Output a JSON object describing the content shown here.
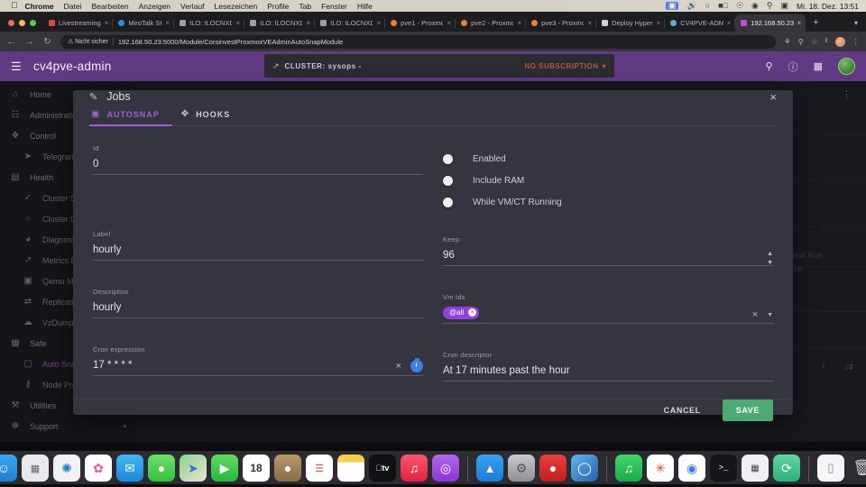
{
  "os_menubar": {
    "apple_icon": "apple-logo",
    "items": [
      "Chrome",
      "Datei",
      "Bearbeiten",
      "Anzeigen",
      "Verlauf",
      "Lesezeichen",
      "Profile",
      "Tab",
      "Fenster",
      "Hilfe"
    ],
    "status_icons": [
      "screen-share-icon",
      "volume-icon",
      "control-center-icon",
      "battery-icon",
      "airdrop-icon",
      "wifi-icon",
      "search-icon",
      "user-switch-icon"
    ],
    "clock": "Mi. 18. Dez.  13:51"
  },
  "browser": {
    "traffic_lights": [
      "close",
      "minimize",
      "zoom"
    ],
    "tabs": [
      {
        "label": "Livestreaming",
        "favicon_color": "#e0443e",
        "active": false
      },
      {
        "label": "MiroTalk SI",
        "favicon_color": "#2f8fd6",
        "active": false
      },
      {
        "label": "ILO: ILOCNXD",
        "favicon_color": "#9aa0a6",
        "active": false
      },
      {
        "label": "ILO: ILOCNXD",
        "favicon_color": "#9aa0a6",
        "active": false
      },
      {
        "label": "ILO: ILOCNXD",
        "favicon_color": "#9aa0a6",
        "active": false
      },
      {
        "label": "pve1 - Proxmo",
        "favicon_color": "#e8803a",
        "active": false
      },
      {
        "label": "pve2 - Proxmo",
        "favicon_color": "#e8803a",
        "active": false
      },
      {
        "label": "pve3 - Proxmo",
        "favicon_color": "#e8803a",
        "active": false
      },
      {
        "label": "Deploy Hyper",
        "favicon_color": "#d0d0d4",
        "active": false
      },
      {
        "label": "CV4PVE-ADM",
        "favicon_color": "#5ab0c8",
        "active": false
      },
      {
        "label": "192.168.50.23",
        "favicon_color": "#b44fd8",
        "active": true
      }
    ],
    "new_tab_label": "+",
    "tab_list_chevron": "chevron-down-icon",
    "nav": {
      "back": "←",
      "forward": "→",
      "reload": "↻"
    },
    "omnibox": {
      "security_label": "Nicht sicher",
      "security_icon": "warning-triangle-icon",
      "url": "192.168.50.23:5000/Module/CorsinvestProxmoxVEAdminAutoSnapModule"
    },
    "toolbar_icons": [
      "extensions-icon",
      "zoom-icon",
      "bookmark-star-icon",
      "downloads-icon",
      "profile-avatar",
      "menu-kebab-icon"
    ]
  },
  "app_header": {
    "menu_icon": "hamburger-menu-icon",
    "brand": "cv4pve-admin",
    "cluster_icon": "external-link-icon",
    "cluster_label": "CLUSTER: sysops -",
    "subscription_label": "NO SUBSCRIPTION",
    "subscription_caret": "caret-down-icon",
    "icons": [
      "search-icon",
      "help-icon",
      "apps-grid-icon"
    ],
    "avatar": "user-avatar"
  },
  "sidebar": {
    "items": [
      {
        "label": "Home",
        "icon": "home-icon",
        "sub": false,
        "active": false
      },
      {
        "label": "Administration",
        "icon": "administration-icon",
        "sub": false,
        "active": false
      },
      {
        "label": "Control",
        "icon": "control-icon",
        "sub": false,
        "active": false
      },
      {
        "label": "Telegram",
        "icon": "telegram-icon",
        "sub": true,
        "active": false
      },
      {
        "label": "Health",
        "icon": "health-icon",
        "sub": false,
        "active": false
      },
      {
        "label": "Cluster S",
        "icon": "cluster-status-icon",
        "sub": true,
        "active": false
      },
      {
        "label": "Cluster U",
        "icon": "cluster-update-icon",
        "sub": true,
        "active": false
      },
      {
        "label": "Diagnostic",
        "icon": "stethoscope-icon",
        "sub": true,
        "active": false
      },
      {
        "label": "Metrics E",
        "icon": "metrics-icon",
        "sub": true,
        "active": false
      },
      {
        "label": "Qemu Mo",
        "icon": "qemu-monitor-icon",
        "sub": true,
        "active": false
      },
      {
        "label": "Replication",
        "icon": "replication-icon",
        "sub": true,
        "active": false
      },
      {
        "label": "VzDump",
        "icon": "vzdump-cloud-icon",
        "sub": true,
        "active": false
      },
      {
        "label": "Safe",
        "icon": "safe-icon",
        "sub": false,
        "active": false
      },
      {
        "label": "Auto Snapshot",
        "icon": "auto-snapshot-icon",
        "sub": true,
        "active": true
      },
      {
        "label": "Node Protection",
        "icon": "shield-icon",
        "sub": true,
        "active": false
      },
      {
        "label": "Utilities",
        "icon": "utilities-icon",
        "sub": false,
        "active": false
      },
      {
        "label": "Support",
        "icon": "support-icon",
        "sub": false,
        "active": false,
        "chevron": "chevron-down-icon"
      }
    ]
  },
  "background_page": {
    "kebab_icon": "more-vertical-icon",
    "column_header": "Next Run",
    "cell_text": "ne",
    "pager_next": "next-page-icon",
    "pager_last": "last-page-icon"
  },
  "dialog": {
    "title": "Jobs",
    "title_icon": "pencil-edit-icon",
    "close_icon": "close-icon",
    "tabs": [
      {
        "label": "AUTOSNAP",
        "icon": "camera-icon",
        "selected": true
      },
      {
        "label": "HOOKS",
        "icon": "hooks-move-icon",
        "selected": false
      }
    ],
    "fields": {
      "id": {
        "label": "Id",
        "value": "0"
      },
      "label": {
        "label": "Label",
        "value": "hourly"
      },
      "description": {
        "label": "Description",
        "value": "hourly"
      },
      "cron_expression": {
        "label": "Cron expression",
        "value": "17 * * * *",
        "clear_icon": "close-icon",
        "timer_icon": "timer-icon"
      },
      "keep": {
        "label": "Keep",
        "value": "96",
        "spinner_up": "chevron-up-icon",
        "spinner_down": "chevron-down-icon"
      },
      "vm_ids": {
        "label": "Vm Ids",
        "chip": "@all",
        "chip_remove_icon": "chip-close-icon",
        "clear_icon": "close-icon",
        "dropdown_icon": "caret-down-icon"
      },
      "cron_descriptor": {
        "label": "Cron descriptor",
        "value": "At 17 minutes past the hour"
      }
    },
    "toggles": [
      {
        "label": "Enabled",
        "state": "off"
      },
      {
        "label": "Include RAM",
        "state": "off"
      },
      {
        "label": "While VM/CT Running",
        "state": "off"
      }
    ],
    "buttons": {
      "cancel": "CANCEL",
      "save": "SAVE"
    }
  },
  "dock": {
    "items": [
      {
        "name": "finder",
        "glyph": "☺",
        "bg": "linear-gradient(to bottom,#39a7ef,#1f7fd0)",
        "running": true
      },
      {
        "name": "launchpad",
        "glyph": "☰",
        "bg": "#e9e9ec",
        "running": false
      },
      {
        "name": "safari",
        "glyph": "✦",
        "bg": "#f2f2f4",
        "running": false
      },
      {
        "name": "photos",
        "glyph": "✿",
        "bg": "#ffffff",
        "running": false
      },
      {
        "name": "mail",
        "glyph": "✉",
        "bg": "linear-gradient(to bottom,#42b6f5,#1e86df)",
        "running": false
      },
      {
        "name": "messages",
        "glyph": "◯",
        "bg": "linear-gradient(to bottom,#6ee06a,#34c13a)",
        "running": false
      },
      {
        "name": "maps",
        "glyph": "➤",
        "bg": "linear-gradient(135deg,#8ed08e,#e8e4d2)",
        "running": false
      },
      {
        "name": "facetime",
        "glyph": "▶",
        "bg": "linear-gradient(to bottom,#5fdd62,#25b83c)",
        "running": false
      },
      {
        "name": "calendar",
        "glyph": "18",
        "bg": "#ffffff",
        "running": false
      },
      {
        "name": "contacts",
        "glyph": "●",
        "bg": "linear-gradient(to bottom,#b79a6c,#8a6c45)",
        "running": false
      },
      {
        "name": "reminders",
        "glyph": "☰",
        "bg": "#ffffff",
        "running": false
      },
      {
        "name": "notes",
        "glyph": "▀",
        "bg": "#ffffff",
        "running": false
      },
      {
        "name": "apple-tv",
        "glyph": "tv",
        "bg": "#111114",
        "running": false
      },
      {
        "name": "music",
        "glyph": "♫",
        "bg": "linear-gradient(to bottom,#f8576e,#e32144)",
        "running": false
      },
      {
        "name": "podcasts",
        "glyph": "ⓘ",
        "bg": "linear-gradient(to bottom,#b168ec,#8a35d8)",
        "running": false
      },
      {
        "name": "app-store",
        "glyph": "A",
        "bg": "linear-gradient(to bottom,#38a3f0,#1e7ad6)",
        "running": false
      },
      {
        "name": "system-settings",
        "glyph": "⚙",
        "bg": "linear-gradient(to bottom,#c9c9cf,#8e8e96)",
        "running": false
      },
      {
        "name": "anydesk",
        "glyph": "●",
        "bg": "linear-gradient(to bottom,#e8403c,#c01f22)",
        "running": false
      },
      {
        "name": "quicklook",
        "glyph": "◯",
        "bg": "linear-gradient(135deg,#5fb6ee,#2a5fa8)",
        "running": false
      },
      {
        "name": "spotify",
        "glyph": "♪",
        "bg": "linear-gradient(to bottom,#3fd86b,#1aa84a)",
        "running": true
      },
      {
        "name": "unraid",
        "glyph": "✳",
        "bg": "#ffffff",
        "running": true
      },
      {
        "name": "chrome",
        "glyph": "◯",
        "bg": "#ffffff",
        "running": true
      },
      {
        "name": "terminal",
        "glyph": ">_",
        "bg": "#16161a",
        "running": true
      },
      {
        "name": "calculator",
        "glyph": "░",
        "bg": "#f0f0f2",
        "running": true
      },
      {
        "name": "sync-tool",
        "glyph": "⟳",
        "bg": "linear-gradient(to bottom,#5ed8a4,#2fae76)",
        "running": true
      },
      {
        "name": "document",
        "glyph": "▯",
        "bg": "#f6f6f8",
        "running": false
      },
      {
        "name": "trash",
        "glyph": "♻",
        "bg": "transparent",
        "running": false
      }
    ]
  }
}
